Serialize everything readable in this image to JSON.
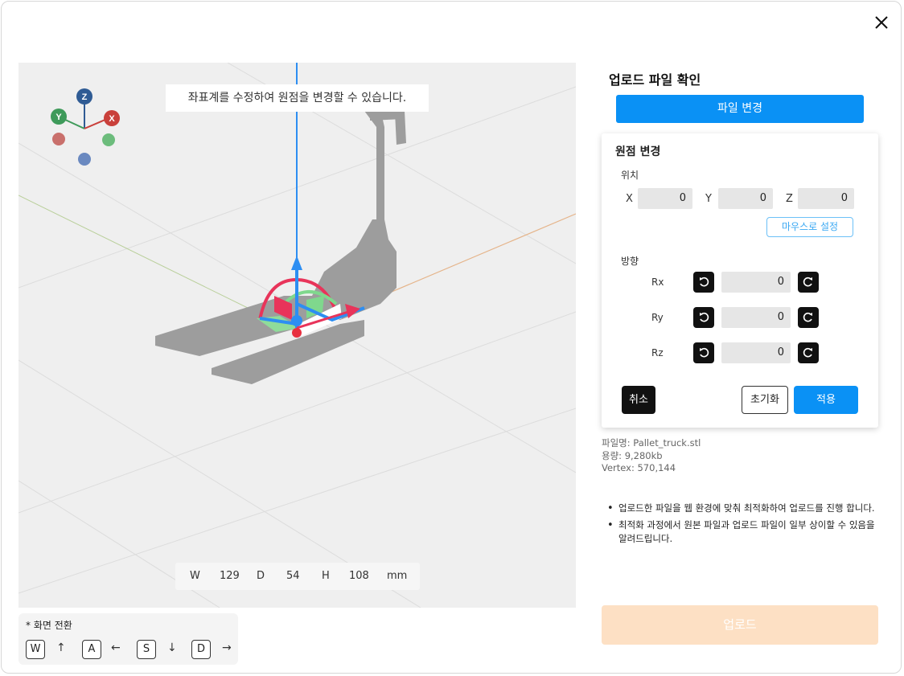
{
  "viewport": {
    "hint": "좌표계를 수정하여 원점을 변경할 수 있습니다.",
    "gizmo": {
      "z": "Z",
      "y": "Y",
      "x": "X"
    },
    "dims": {
      "w_label": "W",
      "w": "129",
      "d_label": "D",
      "d": "54",
      "h_label": "H",
      "h": "108",
      "unit": "mm"
    }
  },
  "keys": {
    "title": "* 화면 전환",
    "items": [
      {
        "key": "W",
        "arrow": "↑"
      },
      {
        "key": "A",
        "arrow": "←"
      },
      {
        "key": "S",
        "arrow": "↓"
      },
      {
        "key": "D",
        "arrow": "→"
      }
    ]
  },
  "panel": {
    "title": "업로드 파일 확인",
    "change_file": "파일 변경",
    "origin": {
      "title": "원점 변경",
      "position_label": "위치",
      "x_label": "X",
      "x": "0",
      "y_label": "Y",
      "y": "0",
      "z_label": "Z",
      "z": "0",
      "mouse_button": "마우스로 설정",
      "direction_label": "방향",
      "rx_label": "Rx",
      "rx": "0",
      "ry_label": "Ry",
      "ry": "0",
      "rz_label": "Rz",
      "rz": "0",
      "cancel": "취소",
      "reset": "초기화",
      "apply": "적용"
    },
    "file_info": {
      "name": "파일명: Pallet_truck.stl",
      "size": "용량: 9,280kb",
      "vertex": "Vertex: 570,144"
    },
    "notes": [
      "업로드한 파일을 웹 환경에 맞춰 최적화하여 업로드를 진행 합니다.",
      "최적화 과정에서 원본 파일과 업로드 파일이 일부 상이할 수 있음을 알려드립니다."
    ],
    "upload": "업로드"
  },
  "colors": {
    "primary": "#0a91f5",
    "upload_disabled": "#fde0c4",
    "axis_x": "#c9403b",
    "axis_y": "#3e9a5a",
    "axis_z": "#2f5b94"
  }
}
